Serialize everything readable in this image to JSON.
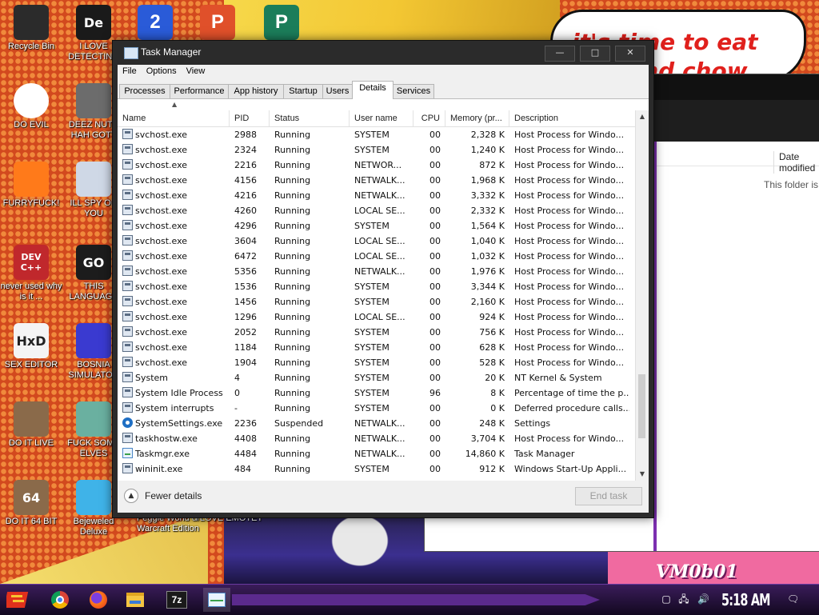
{
  "wallpaper": {
    "bubble_text": "it's time to eat shit and chow",
    "corner_text": "VM0b01"
  },
  "desktop_icons": [
    {
      "label": "Recycle Bin",
      "icon": "recycle-bin-icon",
      "color": "#2b2b2b"
    },
    {
      "label": "I LOVE DETECTING",
      "icon": "detective-app-icon",
      "color": "#1a1a1a",
      "glyph": "De"
    },
    {
      "label": "DO EVIL",
      "icon": "chrome-icon",
      "color": "#ffffff"
    },
    {
      "label": "DEEZ NUTS HAH GOTT",
      "icon": "windows-stack-icon",
      "color": "#6c6c6c"
    },
    {
      "label": "FURRYFUCK!",
      "icon": "firefox-icon",
      "color": "#ff7a1a"
    },
    {
      "label": "ILL SPY ON YOU",
      "icon": "network-spy-icon",
      "color": "#cfd8e6"
    },
    {
      "label": "never used why is it ...",
      "icon": "devcpp-icon",
      "color": "#c0282c",
      "glyph": "DEV C++"
    },
    {
      "label": "THIS LANGUAGE",
      "icon": "goland-icon",
      "color": "#1c1c1c",
      "glyph": "GO"
    },
    {
      "label": "SEX EDITOR",
      "icon": "hxd-icon",
      "color": "#f4f4f4",
      "glyph": "HxD"
    },
    {
      "label": "BOSNIA SIMULATOR",
      "icon": "mine-icon",
      "color": "#3a3ad0"
    },
    {
      "label": "DO IT LIVE",
      "icon": "portrait-icon",
      "color": "#8a6a4a"
    },
    {
      "label": "FUCK SOME ELVES",
      "icon": "santa-icon",
      "color": "#6ab0a0"
    },
    {
      "label": "DO IT 64 BIT",
      "icon": "portrait-64-icon",
      "color": "#8a6a4a",
      "glyph": "64"
    },
    {
      "label": "Bejeweled Deluxe",
      "icon": "gem-icon",
      "color": "#3fb3e8"
    },
    {
      "label": "Peggle World of Warcraft Edition",
      "icon": "",
      "color": ""
    },
    {
      "label": "I LOVE EMOTET",
      "icon": "",
      "color": ""
    }
  ],
  "top_apps": [
    {
      "icon": "app-2-icon",
      "color": "#2a5bd8",
      "glyph": "2"
    },
    {
      "icon": "app-p-icon",
      "color": "#e0502a",
      "glyph": "P"
    },
    {
      "icon": "publisher-icon",
      "color": "#1b7d5a",
      "glyph": "P"
    }
  ],
  "explorer": {
    "column_header": "Date modified",
    "empty_text": "This folder is empty."
  },
  "taskmanager": {
    "title": "Task Manager",
    "window_buttons": {
      "minimize": "—",
      "maximize": "□",
      "close": "✕"
    },
    "menu": [
      "File",
      "Options",
      "View"
    ],
    "tabs": [
      "Processes",
      "Performance",
      "App history",
      "Startup",
      "Users",
      "Details",
      "Services"
    ],
    "active_tab": "Details",
    "columns": [
      "Name",
      "PID",
      "Status",
      "User name",
      "CPU",
      "Memory (pr...",
      "Description"
    ],
    "rows": [
      {
        "name": "svchost.exe",
        "pid": "2988",
        "status": "Running",
        "user": "SYSTEM",
        "cpu": "00",
        "mem": "2,328 K",
        "desc": "Host Process for Windo...",
        "icon": "process-icon"
      },
      {
        "name": "svchost.exe",
        "pid": "2324",
        "status": "Running",
        "user": "SYSTEM",
        "cpu": "00",
        "mem": "1,240 K",
        "desc": "Host Process for Windo...",
        "icon": "process-icon"
      },
      {
        "name": "svchost.exe",
        "pid": "2216",
        "status": "Running",
        "user": "NETWOR...",
        "cpu": "00",
        "mem": "872 K",
        "desc": "Host Process for Windo...",
        "icon": "process-icon"
      },
      {
        "name": "svchost.exe",
        "pid": "4156",
        "status": "Running",
        "user": "NETWALK...",
        "cpu": "00",
        "mem": "1,968 K",
        "desc": "Host Process for Windo...",
        "icon": "process-icon"
      },
      {
        "name": "svchost.exe",
        "pid": "4216",
        "status": "Running",
        "user": "NETWALK...",
        "cpu": "00",
        "mem": "3,332 K",
        "desc": "Host Process for Windo...",
        "icon": "process-icon"
      },
      {
        "name": "svchost.exe",
        "pid": "4260",
        "status": "Running",
        "user": "LOCAL SE...",
        "cpu": "00",
        "mem": "2,332 K",
        "desc": "Host Process for Windo...",
        "icon": "process-icon"
      },
      {
        "name": "svchost.exe",
        "pid": "4296",
        "status": "Running",
        "user": "SYSTEM",
        "cpu": "00",
        "mem": "1,564 K",
        "desc": "Host Process for Windo...",
        "icon": "process-icon"
      },
      {
        "name": "svchost.exe",
        "pid": "3604",
        "status": "Running",
        "user": "LOCAL SE...",
        "cpu": "00",
        "mem": "1,040 K",
        "desc": "Host Process for Windo...",
        "icon": "process-icon"
      },
      {
        "name": "svchost.exe",
        "pid": "6472",
        "status": "Running",
        "user": "LOCAL SE...",
        "cpu": "00",
        "mem": "1,032 K",
        "desc": "Host Process for Windo...",
        "icon": "process-icon"
      },
      {
        "name": "svchost.exe",
        "pid": "5356",
        "status": "Running",
        "user": "NETWALK...",
        "cpu": "00",
        "mem": "1,976 K",
        "desc": "Host Process for Windo...",
        "icon": "process-icon"
      },
      {
        "name": "svchost.exe",
        "pid": "1536",
        "status": "Running",
        "user": "SYSTEM",
        "cpu": "00",
        "mem": "3,344 K",
        "desc": "Host Process for Windo...",
        "icon": "process-icon"
      },
      {
        "name": "svchost.exe",
        "pid": "1456",
        "status": "Running",
        "user": "SYSTEM",
        "cpu": "00",
        "mem": "2,160 K",
        "desc": "Host Process for Windo...",
        "icon": "process-icon"
      },
      {
        "name": "svchost.exe",
        "pid": "1296",
        "status": "Running",
        "user": "LOCAL SE...",
        "cpu": "00",
        "mem": "924 K",
        "desc": "Host Process for Windo...",
        "icon": "process-icon"
      },
      {
        "name": "svchost.exe",
        "pid": "2052",
        "status": "Running",
        "user": "SYSTEM",
        "cpu": "00",
        "mem": "756 K",
        "desc": "Host Process for Windo...",
        "icon": "process-icon"
      },
      {
        "name": "svchost.exe",
        "pid": "1184",
        "status": "Running",
        "user": "SYSTEM",
        "cpu": "00",
        "mem": "628 K",
        "desc": "Host Process for Windo...",
        "icon": "process-icon"
      },
      {
        "name": "svchost.exe",
        "pid": "1904",
        "status": "Running",
        "user": "SYSTEM",
        "cpu": "00",
        "mem": "528 K",
        "desc": "Host Process for Windo...",
        "icon": "process-icon"
      },
      {
        "name": "System",
        "pid": "4",
        "status": "Running",
        "user": "SYSTEM",
        "cpu": "00",
        "mem": "20 K",
        "desc": "NT Kernel & System",
        "icon": "process-icon"
      },
      {
        "name": "System Idle Process",
        "pid": "0",
        "status": "Running",
        "user": "SYSTEM",
        "cpu": "96",
        "mem": "8 K",
        "desc": "Percentage of time the p...",
        "icon": "process-icon"
      },
      {
        "name": "System interrupts",
        "pid": "-",
        "status": "Running",
        "user": "SYSTEM",
        "cpu": "00",
        "mem": "0 K",
        "desc": "Deferred procedure calls...",
        "icon": "process-icon"
      },
      {
        "name": "SystemSettings.exe",
        "pid": "2236",
        "status": "Suspended",
        "user": "NETWALK...",
        "cpu": "00",
        "mem": "248 K",
        "desc": "Settings",
        "icon": "settings-gear-icon"
      },
      {
        "name": "taskhostw.exe",
        "pid": "4408",
        "status": "Running",
        "user": "NETWALK...",
        "cpu": "00",
        "mem": "3,704 K",
        "desc": "Host Process for Windo...",
        "icon": "process-icon"
      },
      {
        "name": "Taskmgr.exe",
        "pid": "4484",
        "status": "Running",
        "user": "NETWALK...",
        "cpu": "00",
        "mem": "14,860 K",
        "desc": "Task Manager",
        "icon": "task-manager-icon"
      },
      {
        "name": "wininit.exe",
        "pid": "484",
        "status": "Running",
        "user": "SYSTEM",
        "cpu": "00",
        "mem": "912 K",
        "desc": "Windows Start-Up Appli...",
        "icon": "process-icon"
      }
    ],
    "fewer_details": "Fewer details",
    "end_task": "End task"
  },
  "taskbar": {
    "apps": [
      "chrome-icon",
      "firefox-icon",
      "file-explorer-icon",
      "7zip-icon",
      "task-manager-icon"
    ],
    "seven_zip_label": "7z",
    "clock": "5:18 AM"
  }
}
